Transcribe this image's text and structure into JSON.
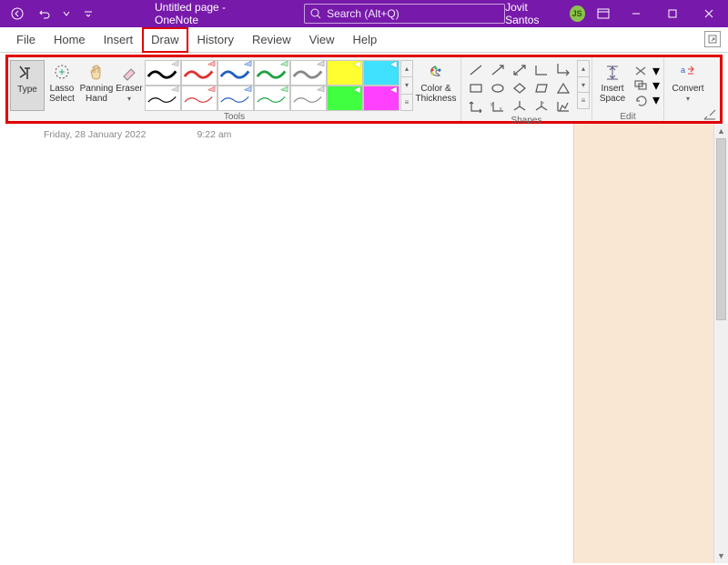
{
  "titlebar": {
    "title": "Untitled page  -  OneNote",
    "search_placeholder": "Search (Alt+Q)",
    "user_name": "Jovit Santos",
    "user_initials": "JS"
  },
  "menu": {
    "tabs": [
      "File",
      "Home",
      "Insert",
      "Draw",
      "History",
      "Review",
      "View",
      "Help"
    ],
    "active_index": 3
  },
  "ribbon": {
    "tools": {
      "type_label": "Type",
      "lasso_label": "Lasso\nSelect",
      "panning_label": "Panning\nHand",
      "eraser_label": "Eraser",
      "color_thickness_label": "Color &\nThickness",
      "group_label": "Tools",
      "pens_row1": [
        "#000000",
        "#e03030",
        "#2060c0",
        "#20a040",
        "#888888"
      ],
      "highlighters_row1": [
        "#ffff30",
        "#40e0ff"
      ],
      "pens_row2_thin": [
        "#000000",
        "#e03030",
        "#2060c0",
        "#20a040",
        "#888888"
      ],
      "highlighters_row2": [
        "#40ff40",
        "#ff40ff"
      ]
    },
    "shapes": {
      "group_label": "Shapes"
    },
    "edit": {
      "insert_space_label": "Insert\nSpace",
      "group_label": "Edit"
    },
    "convert": {
      "label": "Convert"
    }
  },
  "page": {
    "date": "Friday, 28 January 2022",
    "time": "9:22 am"
  }
}
